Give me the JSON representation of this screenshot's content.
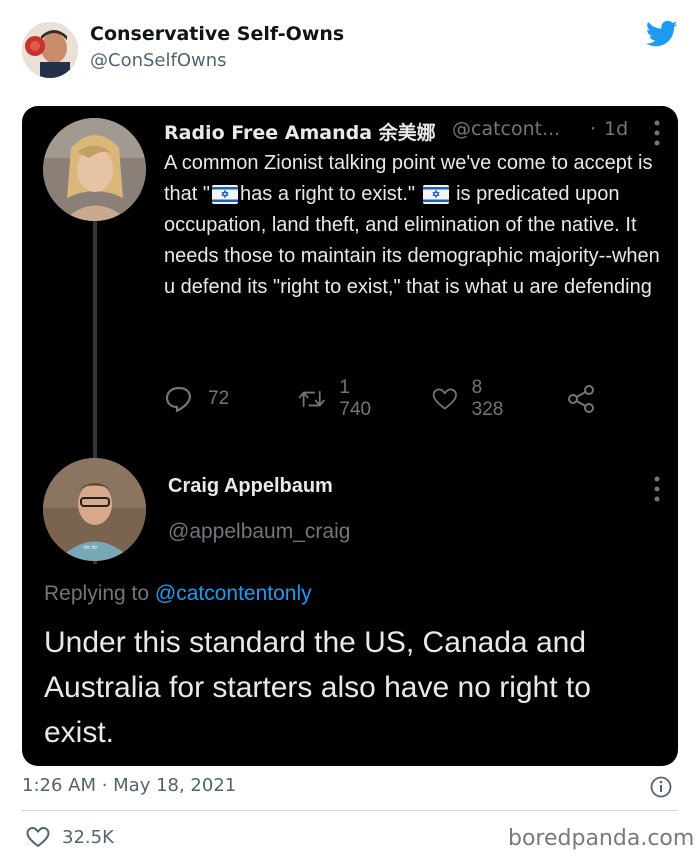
{
  "outer_tweet": {
    "display_name": "Conservative Self-Owns",
    "handle": "@ConSelfOwns",
    "timestamp": "1:26 AM · May 18, 2021",
    "likes": "32.5K"
  },
  "quoted_thread": {
    "first": {
      "display_name": "Radio Free Amanda 余美娜",
      "handle": "@catcont...",
      "separator": "·",
      "age": "1d",
      "text_parts": [
        "A common Zionist talking point we've come to accept is that \"",
        "has a right to exist.\" ",
        " is predicated upon occupation, land theft, and elimination of the native. It needs those to maintain its demographic majority--when u defend its \"right to exist,\" that is what u are defending"
      ],
      "flag_icon": "israel-flag-emoji",
      "replies": "72",
      "retweets": "1 740",
      "likes": "8 328"
    },
    "reply": {
      "display_name": "Craig Appelbaum",
      "handle": "@appelbaum_craig",
      "replying_prefix": "Replying to ",
      "replying_to": "@catcontentonly",
      "text": "Under this standard the US, Canada and Australia for starters also have no right to exist."
    }
  },
  "watermark": "boredpanda.com",
  "colors": {
    "twitter_blue": "#1d9bf0",
    "dark_bg": "#000000",
    "dark_text": "#e7e9ea",
    "dark_muted": "#71767b",
    "light_muted": "#536471"
  }
}
